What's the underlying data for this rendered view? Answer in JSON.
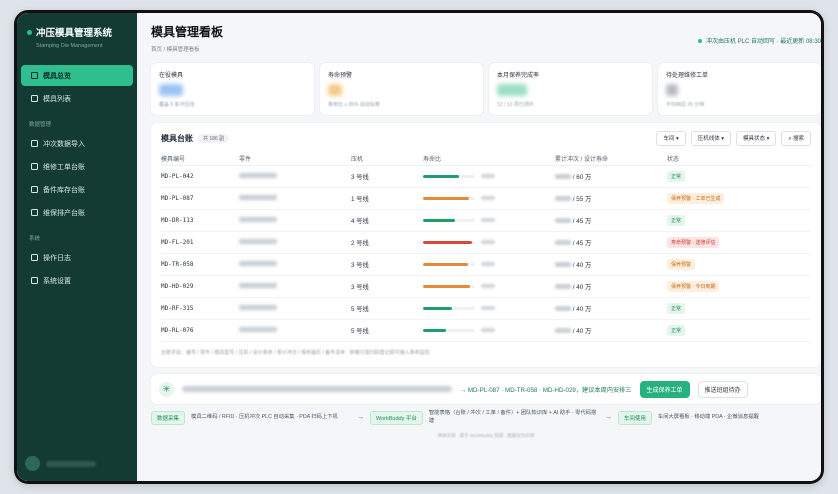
{
  "sidebar": {
    "title": "冲压模具管理系统",
    "subtitle": "Stamping Die Management",
    "items_main": [
      {
        "label": "模具总览",
        "active": true
      },
      {
        "label": "模具列表",
        "active": false
      }
    ],
    "group_data": "数据管理",
    "items_data": [
      {
        "label": "冲次数据导入"
      },
      {
        "label": "维修工单台账"
      },
      {
        "label": "备件库存台账"
      },
      {
        "label": "维保排产台账"
      }
    ],
    "group_system": "系统",
    "items_system": [
      {
        "label": "操作日志"
      },
      {
        "label": "系统设置"
      }
    ]
  },
  "header": {
    "title": "模具管理看板",
    "breadcrumb": "首页 / 模具管理看板",
    "status": "冲次由压机 PLC 自动回写 · 最近更新 08:30"
  },
  "cards": [
    {
      "label": "在役模具",
      "foot": "覆盖 5 条冲压线",
      "accent": "#3b82f6"
    },
    {
      "label": "寿命预警",
      "foot": "寿命比 ≥ 85% 自动标黄",
      "accent": "#f59e0b"
    },
    {
      "label": "本月保养完成率",
      "foot": "12 / 13 项已闭环",
      "accent": "#10b981"
    },
    {
      "label": "待处理维修工单",
      "foot": "平均响应 26 分钟",
      "accent": "#9ca3af"
    }
  ],
  "table": {
    "title": "模具台账",
    "count": "共 186 副",
    "filters": [
      "车间",
      "压机线体",
      "模具状态",
      "搜索"
    ],
    "columns": [
      "模具编号",
      "零件",
      "压机",
      "寿命比",
      "累计冲次 / 设计寿命",
      "状态"
    ],
    "rows": [
      {
        "id": "MD-PL-042",
        "press": "3 号线",
        "ratio": 0.7,
        "color": "#1f9d6b",
        "life": "60 万",
        "status": "正常",
        "tone": "ok"
      },
      {
        "id": "MD-PL-087",
        "press": "1 号线",
        "ratio": 0.88,
        "color": "#e58a3a",
        "life": "55 万",
        "status": "保养预警 · 工单已生成",
        "tone": "warn"
      },
      {
        "id": "MD-DR-113",
        "press": "4 号线",
        "ratio": 0.62,
        "color": "#1f9d6b",
        "life": "45 万",
        "status": "正常",
        "tone": "ok"
      },
      {
        "id": "MD-FL-201",
        "press": "2 号线",
        "ratio": 0.95,
        "color": "#d9483b",
        "life": "45 万",
        "status": "寿命预警 · 送修评估",
        "tone": "danger"
      },
      {
        "id": "MD-TR-058",
        "press": "3 号线",
        "ratio": 0.86,
        "color": "#e58a3a",
        "life": "40 万",
        "status": "保养预警",
        "tone": "warn"
      },
      {
        "id": "MD-HD-029",
        "press": "3 号线",
        "ratio": 0.9,
        "color": "#e58a3a",
        "life": "40 万",
        "status": "保养预警 · 今日到期",
        "tone": "warn"
      },
      {
        "id": "MD-RF-315",
        "press": "5 号线",
        "ratio": 0.55,
        "color": "#1f9d6b",
        "life": "40 万",
        "status": "正常",
        "tone": "ok"
      },
      {
        "id": "MD-RL-076",
        "press": "5 号线",
        "ratio": 0.45,
        "color": "#1f9d6b",
        "life": "40 万",
        "status": "正常",
        "tone": "ok"
      }
    ],
    "legend": "台账字段：编号 / 零件 / 模具型号 / 压机 / 设计寿命 / 累计冲次 / 保养履历 / 备件清单 · 新模只需扫码登记即可接入寿命监控"
  },
  "recommendation": {
    "text": "→ MD-PL-087 · MD-TR-058 · MD-HD-029，建议本周内安排三",
    "primary": "生成保养工单",
    "secondary": "推送班组待办"
  },
  "flow": {
    "step1_tag": "数据采集",
    "step1_text": "模具二维码 / RFID · 压机冲次 PLC 自动采集 · PDA 扫码上下机",
    "step2_tag": "WorkBuddy 平台",
    "step2_text": "智能表格（台账 / 冲次 / 工单 / 备件）+ 团队知识库 + AI 助手 · 零代码搭建",
    "step3_tag": "车间使用",
    "step3_text": "车间大屏看板 · 移动端 PDA · 企微消息提醒"
  },
  "footer": "简单示例 · 基于 WorkBuddy 搭建 · 数据仅为示例"
}
